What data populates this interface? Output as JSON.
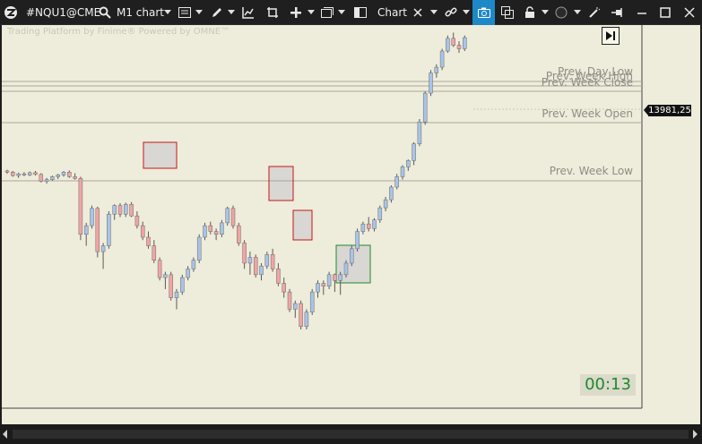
{
  "toolbar": {
    "symbol": "#NQU1@CME",
    "timeframe": "M1 chart",
    "chart_type_label": "Chart",
    "icons": [
      "app-logo-icon",
      "search-icon",
      "list-icon",
      "pen-icon",
      "line-chart-icon",
      "crop-icon",
      "plus-icon",
      "window-icon",
      "book-icon",
      "cross-icon",
      "link-icon",
      "camera-icon",
      "copy-icon",
      "lock-icon",
      "circle-icon",
      "magic-icon",
      "pin-icon",
      "minimize-icon",
      "maximize-icon",
      "close-icon"
    ],
    "accent_color": "#1e88c8"
  },
  "chart": {
    "watermark": "Trading Platform by Finime® Powered by OMNE™",
    "timer": "00:13",
    "current_price": "13981,25",
    "levels": [
      {
        "label": "Prev. Day Low"
      },
      {
        "label": "Prev. Week High"
      },
      {
        "label": "Prev. Week Close"
      },
      {
        "label": "Prev. Week Open"
      },
      {
        "label": "Prev. Week Low"
      }
    ],
    "colors": {
      "background": "#eeecda",
      "bull": "#a9c4e8",
      "bear": "#f0a5a5",
      "supply_zone": "#c8141a",
      "demand_zone": "#1f8a2a",
      "level_line": "#a9a89c"
    }
  },
  "chart_data": {
    "type": "candlestick",
    "price_tag": 13981.25,
    "candles": [
      [
        13750,
        13752,
        13745,
        13748
      ],
      [
        13748,
        13750,
        13740,
        13742
      ],
      [
        13742,
        13747,
        13738,
        13745
      ],
      [
        13745,
        13748,
        13741,
        13743
      ],
      [
        13743,
        13749,
        13741,
        13747
      ],
      [
        13747,
        13750,
        13742,
        13744
      ],
      [
        13744,
        13746,
        13730,
        13732
      ],
      [
        13732,
        13738,
        13728,
        13735
      ],
      [
        13735,
        13742,
        13733,
        13740
      ],
      [
        13740,
        13745,
        13736,
        13743
      ],
      [
        13743,
        13750,
        13740,
        13748
      ],
      [
        13748,
        13751,
        13738,
        13740
      ],
      [
        13740,
        13746,
        13735,
        13737
      ],
      [
        13737,
        13740,
        13630,
        13640
      ],
      [
        13640,
        13660,
        13620,
        13655
      ],
      [
        13655,
        13690,
        13650,
        13685
      ],
      [
        13685,
        13688,
        13600,
        13610
      ],
      [
        13610,
        13625,
        13580,
        13620
      ],
      [
        13620,
        13680,
        13615,
        13675
      ],
      [
        13675,
        13692,
        13665,
        13690
      ],
      [
        13690,
        13694,
        13670,
        13675
      ],
      [
        13675,
        13695,
        13670,
        13692
      ],
      [
        13692,
        13696,
        13670,
        13672
      ],
      [
        13672,
        13680,
        13650,
        13655
      ],
      [
        13655,
        13662,
        13630,
        13635
      ],
      [
        13635,
        13645,
        13615,
        13620
      ],
      [
        13620,
        13630,
        13590,
        13595
      ],
      [
        13595,
        13600,
        13560,
        13565
      ],
      [
        13565,
        13575,
        13545,
        13570
      ],
      [
        13570,
        13575,
        13525,
        13530
      ],
      [
        13530,
        13545,
        13510,
        13540
      ],
      [
        13540,
        13570,
        13535,
        13565
      ],
      [
        13565,
        13585,
        13560,
        13580
      ],
      [
        13580,
        13600,
        13575,
        13595
      ],
      [
        13595,
        13640,
        13590,
        13635
      ],
      [
        13635,
        13660,
        13630,
        13655
      ],
      [
        13655,
        13662,
        13640,
        13645
      ],
      [
        13645,
        13650,
        13630,
        13640
      ],
      [
        13640,
        13665,
        13635,
        13660
      ],
      [
        13660,
        13688,
        13655,
        13685
      ],
      [
        13685,
        13690,
        13650,
        13655
      ],
      [
        13655,
        13660,
        13620,
        13625
      ],
      [
        13625,
        13630,
        13580,
        13590
      ],
      [
        13590,
        13610,
        13570,
        13600
      ],
      [
        13600,
        13605,
        13565,
        13570
      ],
      [
        13570,
        13590,
        13560,
        13585
      ],
      [
        13585,
        13610,
        13580,
        13605
      ],
      [
        13605,
        13615,
        13575,
        13580
      ],
      [
        13580,
        13590,
        13550,
        13555
      ],
      [
        13555,
        13565,
        13530,
        13540
      ],
      [
        13540,
        13545,
        13505,
        13510
      ],
      [
        13510,
        13525,
        13495,
        13520
      ],
      [
        13520,
        13525,
        13475,
        13480
      ],
      [
        13480,
        13510,
        13475,
        13505
      ],
      [
        13505,
        13545,
        13500,
        13540
      ],
      [
        13540,
        13560,
        13530,
        13555
      ],
      [
        13555,
        13560,
        13535,
        13550
      ],
      [
        13550,
        13575,
        13545,
        13570
      ],
      [
        13570,
        13572,
        13540,
        13560
      ],
      [
        13560,
        13575,
        13535,
        13570
      ],
      [
        13570,
        13595,
        13565,
        13590
      ],
      [
        13590,
        13620,
        13585,
        13615
      ],
      [
        13615,
        13650,
        13610,
        13645
      ],
      [
        13645,
        13662,
        13640,
        13658
      ],
      [
        13658,
        13670,
        13645,
        13650
      ],
      [
        13650,
        13668,
        13645,
        13665
      ],
      [
        13665,
        13690,
        13660,
        13686
      ],
      [
        13686,
        13705,
        13680,
        13700
      ],
      [
        13700,
        13725,
        13695,
        13722
      ],
      [
        13722,
        13745,
        13718,
        13740
      ],
      [
        13740,
        13760,
        13735,
        13757
      ],
      [
        13757,
        13770,
        13750,
        13768
      ],
      [
        13768,
        13800,
        13760,
        13797
      ],
      [
        13797,
        13840,
        13793,
        13835
      ],
      [
        13835,
        13888,
        13830,
        13885
      ],
      [
        13885,
        13925,
        13880,
        13920
      ],
      [
        13920,
        13935,
        13912,
        13930
      ],
      [
        13930,
        13962,
        13925,
        13958
      ],
      [
        13958,
        13985,
        13955,
        13980
      ],
      [
        13980,
        13990,
        13965,
        13968
      ],
      [
        13968,
        13975,
        13955,
        13962
      ],
      [
        13962,
        13985,
        13958,
        13981.25
      ]
    ]
  }
}
